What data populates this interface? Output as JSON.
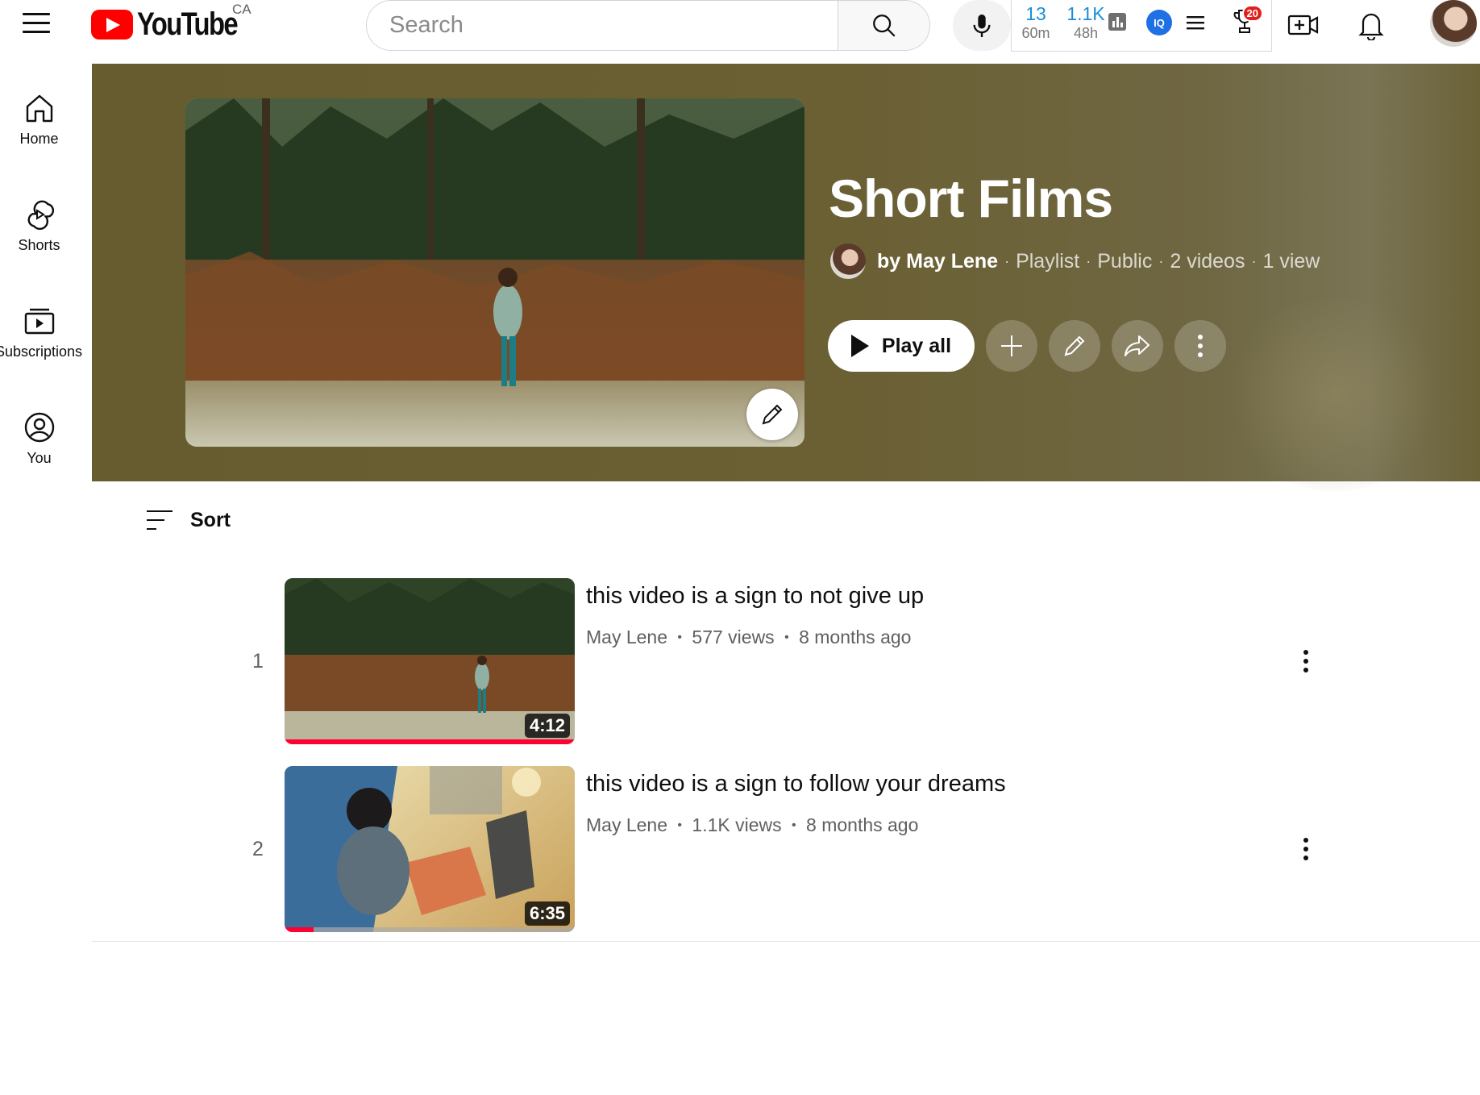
{
  "topbar": {
    "logo_text": "YouTube",
    "region": "CA",
    "search_placeholder": "Search",
    "stats": [
      {
        "value": "13",
        "period": "60m"
      },
      {
        "value": "1.1K",
        "period": "48h"
      }
    ],
    "trophy_badge": "20"
  },
  "sidebar": {
    "items": [
      {
        "label": "Home",
        "icon": "home-icon"
      },
      {
        "label": "Shorts",
        "icon": "shorts-icon"
      },
      {
        "label": "Subscriptions",
        "icon": "subscriptions-icon"
      },
      {
        "label": "You",
        "icon": "you-icon"
      }
    ]
  },
  "playlist": {
    "title": "Short Films",
    "owner": "by May Lene",
    "type": "Playlist",
    "visibility": "Public",
    "video_count": "2 videos",
    "views": "1 view",
    "play_all_label": "Play all"
  },
  "sort": {
    "label": "Sort"
  },
  "videos": [
    {
      "index": "1",
      "title": "this video is a sign to not give up",
      "channel": "May Lene",
      "views": "577 views",
      "age": "8 months ago",
      "duration": "4:12",
      "watched_fraction": 1.0
    },
    {
      "index": "2",
      "title": "this video is a sign to follow your dreams",
      "channel": "May Lene",
      "views": "1.1K views",
      "age": "8 months ago",
      "duration": "6:35",
      "watched_fraction": 0.1
    }
  ],
  "colors": {
    "banner": "#6b6034",
    "brand_red": "#ff0000",
    "progress_red": "#ff0033"
  }
}
